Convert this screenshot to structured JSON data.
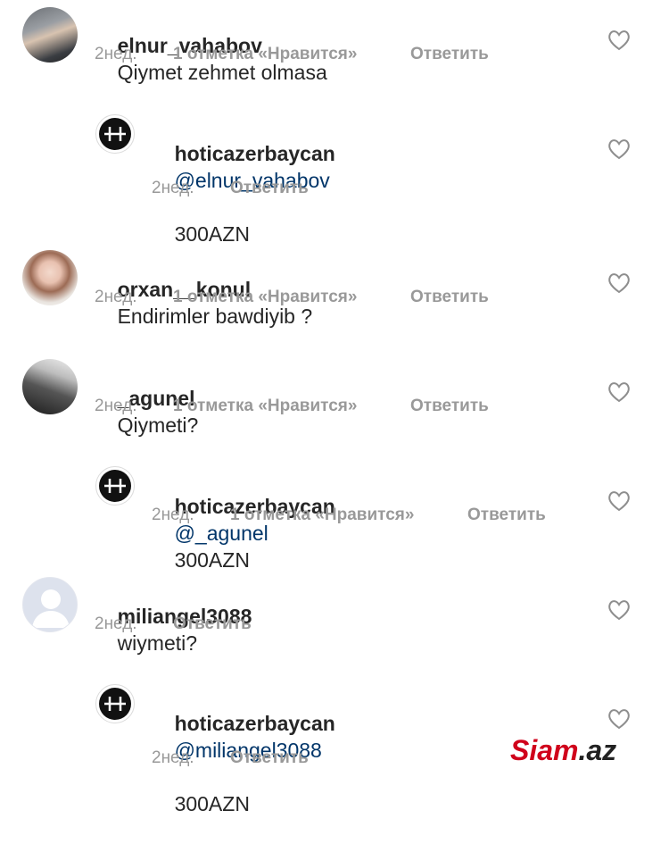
{
  "comments": [
    {
      "username": "elnur_vahabov",
      "text": "Qiymet zehmet olmasa",
      "time": "2нед.",
      "likes": "1 отметка «Нравится»",
      "reply": "Ответить",
      "avatar": "man-in-car-photo"
    },
    {
      "username": "hoticazerbaycan",
      "mention": "@elnur_vahabov",
      "text": "300AZN",
      "time": "2нед.",
      "reply": "Ответить",
      "avatar": "brand-logo"
    },
    {
      "username": "orxan__konul",
      "text": "Endirimler bawdiyib ?",
      "time": "2нед.",
      "likes": "1 отметка «Нравится»",
      "reply": "Ответить",
      "avatar": "woman-portrait-photo"
    },
    {
      "username": "_agunel",
      "text": "Qiymeti?",
      "time": "2нед.",
      "likes": "1 отметка «Нравится»",
      "reply": "Ответить",
      "avatar": "bw-street-photo"
    },
    {
      "username": "hoticazerbaycan",
      "mention": "@_agunel",
      "text": "300AZN",
      "time": "2нед.",
      "likes": "1 отметка «Нравится»",
      "reply": "Ответить",
      "avatar": "brand-logo"
    },
    {
      "username": "miliangel3088",
      "text": "wiymeti?",
      "time": "2нед.",
      "reply": "Ответить",
      "avatar": "default-avatar"
    },
    {
      "username": "hoticazerbaycan",
      "mention": "@miliangel3088",
      "text": "300AZN",
      "time": "2нед.",
      "reply": "Ответить",
      "avatar": "brand-logo"
    }
  ],
  "watermark": {
    "a": "Siam",
    "b": ".az"
  },
  "colors": {
    "mention": "#003569",
    "meta": "#999999",
    "watermark_red": "#d0021b"
  }
}
